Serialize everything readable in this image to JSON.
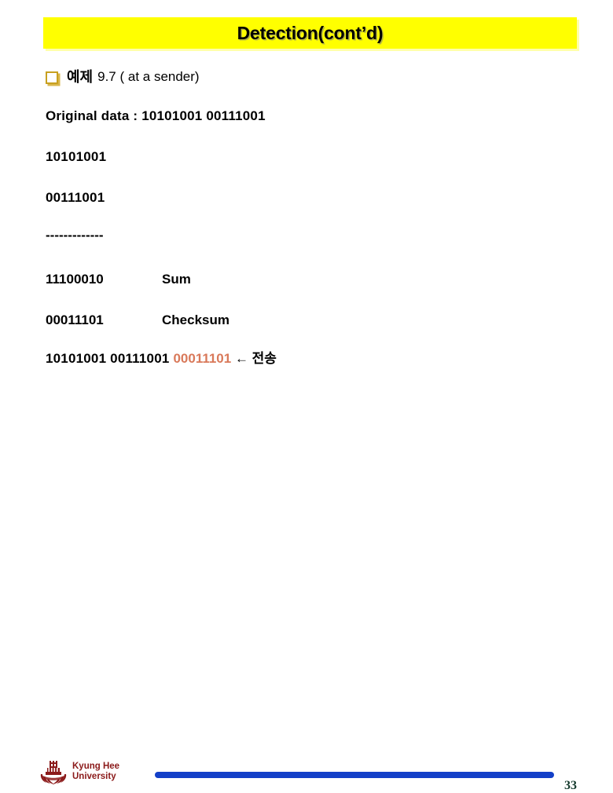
{
  "slide": {
    "title": "Detection(cont’d)",
    "page_number": "33",
    "title_bg_color": "#FFFF00",
    "accent_bar_color": "#1340C8",
    "highlight_text_color": "#D9795A",
    "bullet_color": "#C8A020"
  },
  "bullet_line": {
    "korean": "예제",
    "rest": "9.7 ( at a sender)"
  },
  "lines": {
    "original_data": "Original data : 10101001 00111001",
    "operand_1": "10101001",
    "operand_2": "00111001",
    "separator": "-------------"
  },
  "rows": [
    {
      "bits": "11100010",
      "label": "Sum"
    },
    {
      "bits": "00011101",
      "label": "Checksum"
    }
  ],
  "result_line": {
    "black_prefix": "10101001 00111001 ",
    "red_bits": "00011101",
    "suffix": " ← 전송"
  },
  "footer": {
    "university_line1": "Kyung Hee",
    "university_line2": "University"
  }
}
